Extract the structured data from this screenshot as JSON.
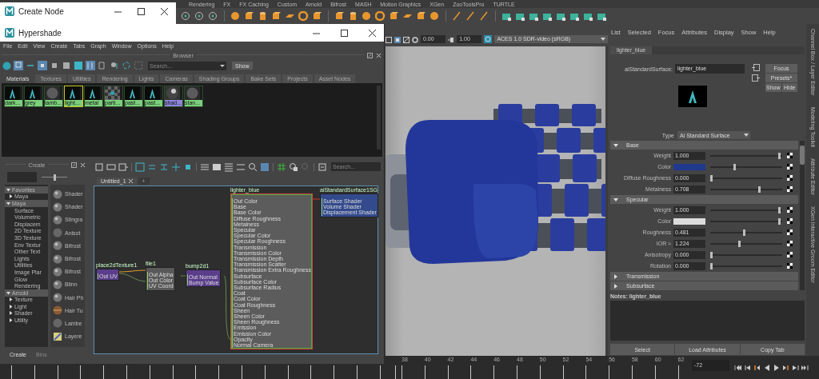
{
  "shelf": {
    "tabs": [
      "Rendering",
      "FX",
      "FX Caching",
      "Custom",
      "Arnold",
      "Bifrost",
      "MASH",
      "Motion Graphics",
      "XGen",
      "ZooToolsPro",
      "TURTLE"
    ]
  },
  "create_node_window": {
    "title": "Create Node"
  },
  "hypershade": {
    "title": "Hypershade",
    "menu": [
      "File",
      "Edit",
      "View",
      "Create",
      "Tabs",
      "Graph",
      "Window",
      "Options",
      "Help"
    ],
    "browser": {
      "title": "Browser",
      "search": {
        "placeholder": "Search..."
      },
      "show_button": "Show",
      "tabs": [
        {
          "label": "Materials",
          "selected": true
        },
        {
          "label": "Textures",
          "selected": false
        },
        {
          "label": "Utilities",
          "selected": false
        },
        {
          "label": "Rendering",
          "selected": false
        },
        {
          "label": "Lights",
          "selected": false
        },
        {
          "label": "Cameras",
          "selected": false
        },
        {
          "label": "Shading Groups",
          "selected": false
        },
        {
          "label": "Bake Sets",
          "selected": false
        },
        {
          "label": "Projects",
          "selected": false
        },
        {
          "label": "Asset Nodes",
          "selected": false
        }
      ],
      "swatches": [
        {
          "label": "dark...",
          "kind": "arnold",
          "selected": false,
          "color": "#7ccf7c"
        },
        {
          "label": "grey",
          "kind": "arnold",
          "selected": false,
          "color": "#7ccf7c"
        },
        {
          "label": "lamb...",
          "kind": "sphere",
          "selected": false,
          "color": "#7ccf7c"
        },
        {
          "label": "light...",
          "kind": "arnold",
          "selected": true,
          "color": "#7ccf7c"
        },
        {
          "label": "metal",
          "kind": "arnold",
          "selected": false,
          "color": "#7ccf7c"
        },
        {
          "label": "parti...",
          "kind": "checker",
          "selected": false,
          "color": "#7ccf7c"
        },
        {
          "label": "past...",
          "kind": "arnold",
          "selected": false,
          "color": "#7ccf7c"
        },
        {
          "label": "past...",
          "kind": "arnold",
          "selected": false,
          "color": "#7ccf7c"
        },
        {
          "label": "shad...",
          "kind": "shiny",
          "selected": false,
          "color": "#8c86d8"
        },
        {
          "label": "stan...",
          "kind": "sphere",
          "selected": false,
          "color": "#7ccf7c"
        }
      ]
    },
    "create_panel": {
      "title": "Create",
      "size_slider": {
        "level": 0.5
      },
      "tree": [
        {
          "label": "Favorites",
          "expanded": true,
          "children": [
            {
              "label": "Maya",
              "expanded": false
            }
          ]
        },
        {
          "label": "Maya",
          "expanded": true,
          "children": [
            {
              "label": "Surface"
            },
            {
              "label": "Volumetric"
            },
            {
              "label": "Displacem"
            },
            {
              "label": "2D Texture"
            },
            {
              "label": "3D Texture"
            },
            {
              "label": "Env Textur"
            },
            {
              "label": "Other Text"
            },
            {
              "label": "Lights"
            },
            {
              "label": "Utilities"
            },
            {
              "label": "Image Plar"
            },
            {
              "label": "Glow"
            },
            {
              "label": "Rendering"
            }
          ]
        },
        {
          "label": "Arnold",
          "expanded": true,
          "children": [
            {
              "label": "Texture",
              "expanded": false
            },
            {
              "label": "Light",
              "expanded": false
            },
            {
              "label": "Shader",
              "expanded": false
            },
            {
              "label": "Utility",
              "expanded": false
            }
          ]
        }
      ],
      "nodes": [
        {
          "label": "Shader",
          "kind": "grey"
        },
        {
          "label": "Shader",
          "kind": "grey"
        },
        {
          "label": "Stingra",
          "kind": "grey"
        },
        {
          "label": "Anisot",
          "kind": "flat"
        },
        {
          "label": "Bifrost",
          "kind": "grey"
        },
        {
          "label": "Bifrost",
          "kind": "grey"
        },
        {
          "label": "Bifrost",
          "kind": "grey"
        },
        {
          "label": "Blinn",
          "kind": "grey"
        },
        {
          "label": "Hair Ph",
          "kind": "grey"
        },
        {
          "label": "Hair Tu",
          "kind": "brown"
        },
        {
          "label": "Lambe",
          "kind": "flat"
        },
        {
          "label": "Layere",
          "kind": "layered"
        }
      ],
      "bottom_tabs": [
        {
          "label": "Create",
          "selected": true
        },
        {
          "label": "Bins",
          "selected": false
        }
      ]
    },
    "node_editor": {
      "search": {
        "placeholder": "Search..."
      },
      "tabs": [
        {
          "label": "Untitled_1",
          "selected": true,
          "closable": true
        },
        {
          "label": "+",
          "selected": false,
          "closable": false
        }
      ],
      "nodes": [
        {
          "title": "place2dTexture1",
          "kind": "utility",
          "selected": false,
          "ports": [
            "Out UV"
          ]
        },
        {
          "title": "file1",
          "kind": "texture",
          "selected": false,
          "ports": [
            "Out Alpha",
            "Out Color",
            "UV Coord"
          ]
        },
        {
          "title": "bump2d1",
          "kind": "utility",
          "selected": false,
          "ports": [
            "Out Normal",
            "Bump Value"
          ]
        },
        {
          "title": "lighter_blue",
          "kind": "shader",
          "selected": true,
          "ports": [
            "Out Color",
            "Base",
            "Base Color",
            "Diffuse Roughness",
            "Metalness",
            "Specular",
            "Specular Color",
            "Specular Roughness",
            "Transmission",
            "Transmission Color",
            "Transmission Depth",
            "Transmission Scatter",
            "Transmission Extra Roughness",
            "Subsurface",
            "Subsurface Color",
            "Subsurface Radius",
            "Coat",
            "Coat Color",
            "Coat Roughness",
            "Sheen",
            "Sheen Color",
            "Sheen Roughness",
            "Emission",
            "Emission Color",
            "Opacity",
            "Normal Camera"
          ]
        },
        {
          "title": "aiStandardSurface1SG",
          "kind": "shading_group",
          "selected": false,
          "ports": [
            "Surface Shader",
            "Volume Shader",
            "Displacement Shader"
          ]
        }
      ]
    }
  },
  "viewport": {
    "exposure": "0.00",
    "gamma": "1.00",
    "view_transform": "ACES 1.0 SDR-video (sRGB)"
  },
  "attribute_editor": {
    "menu": [
      "List",
      "Selected",
      "Focus",
      "Attributes",
      "Display",
      "Show",
      "Help"
    ],
    "tabs": [
      {
        "label": "lighter_blue",
        "selected": true
      }
    ],
    "node_label": "aiStandardSurface:",
    "node_name": "lighter_blue",
    "buttons": [
      "Focus",
      "Presets*",
      "Show",
      "Hide"
    ],
    "type_label": "Type",
    "type_value": "Ai Standard Surface",
    "sections": [
      {
        "title": "Base",
        "expanded": true,
        "rows": [
          {
            "label": "Weight",
            "kind": "number",
            "value": "1.000",
            "level": 0.98
          },
          {
            "label": "Color",
            "kind": "color",
            "color": "#1f3a8f",
            "level": 0.33
          },
          {
            "label": "Diffuse Roughness",
            "kind": "number",
            "value": "0.000",
            "level": 0
          },
          {
            "label": "Metalness",
            "kind": "number",
            "value": "0.708",
            "level": 0.69
          }
        ]
      },
      {
        "title": "Specular",
        "expanded": true,
        "rows": [
          {
            "label": "Weight",
            "kind": "number",
            "value": "1.000",
            "level": 0.98
          },
          {
            "label": "Color",
            "kind": "color",
            "color": "#dcdcdc",
            "level": 0.98
          },
          {
            "label": "Roughness",
            "kind": "number",
            "value": "0.481",
            "level": 0.47
          },
          {
            "label": "IOR ≈",
            "kind": "number",
            "value": "1.224",
            "level": 0.4
          },
          {
            "label": "Anisotropy",
            "kind": "number",
            "value": "0.000",
            "level": 0
          },
          {
            "label": "Rotation",
            "kind": "number",
            "value": "0.000",
            "level": 0
          }
        ]
      },
      {
        "title": "Transmission",
        "expanded": false
      },
      {
        "title": "Subsurface",
        "expanded": false
      }
    ],
    "notes_label": "Notes:  lighter_blue",
    "actions": [
      "Select",
      "Load Attributes",
      "Copy Tab"
    ]
  },
  "side_tabs": [
    "Channel Box / Layer Editor",
    "Modeling Toolkit",
    "Attribute Editor",
    "XGen Interactive Groom Editor"
  ],
  "timeline": {
    "ticks": [
      "38",
      "40",
      "42",
      "44",
      "46",
      "48",
      "50",
      "52",
      "54",
      "56",
      "58",
      "60",
      "62"
    ],
    "current_frame": "-72"
  }
}
